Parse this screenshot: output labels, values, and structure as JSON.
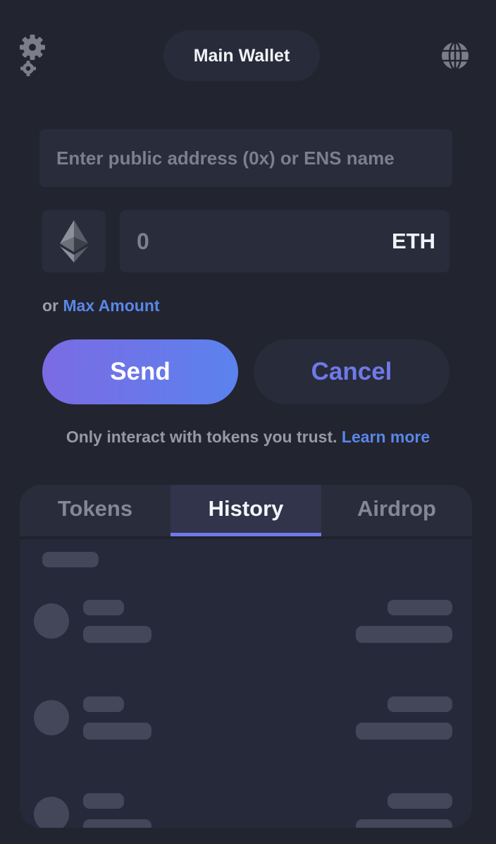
{
  "header": {
    "wallet_name": "Main Wallet",
    "settings_icon": "gear-icon",
    "network_icon": "globe-icon"
  },
  "address": {
    "placeholder": "Enter public address (0x) or ENS name",
    "value": ""
  },
  "amount": {
    "token_icon": "ethereum-icon",
    "placeholder": "0",
    "value": "",
    "unit": "ETH"
  },
  "max_amount": {
    "prefix": "or",
    "link_label": "Max Amount"
  },
  "actions": {
    "send_label": "Send",
    "cancel_label": "Cancel"
  },
  "notice": {
    "text": "Only interact with tokens you trust.",
    "link_label": "Learn more"
  },
  "tabs": [
    {
      "label": "Tokens",
      "active": false
    },
    {
      "label": "History",
      "active": true
    },
    {
      "label": "Airdrop",
      "active": false
    }
  ],
  "history": {
    "state": "loading",
    "skeleton_rows": 3
  },
  "colors": {
    "background": "#22242f",
    "surface": "#292c3b",
    "accent": "#6f79e8",
    "link": "#5a86e8",
    "send_gradient_start": "#7b6be3",
    "send_gradient_end": "#5b82ee"
  }
}
